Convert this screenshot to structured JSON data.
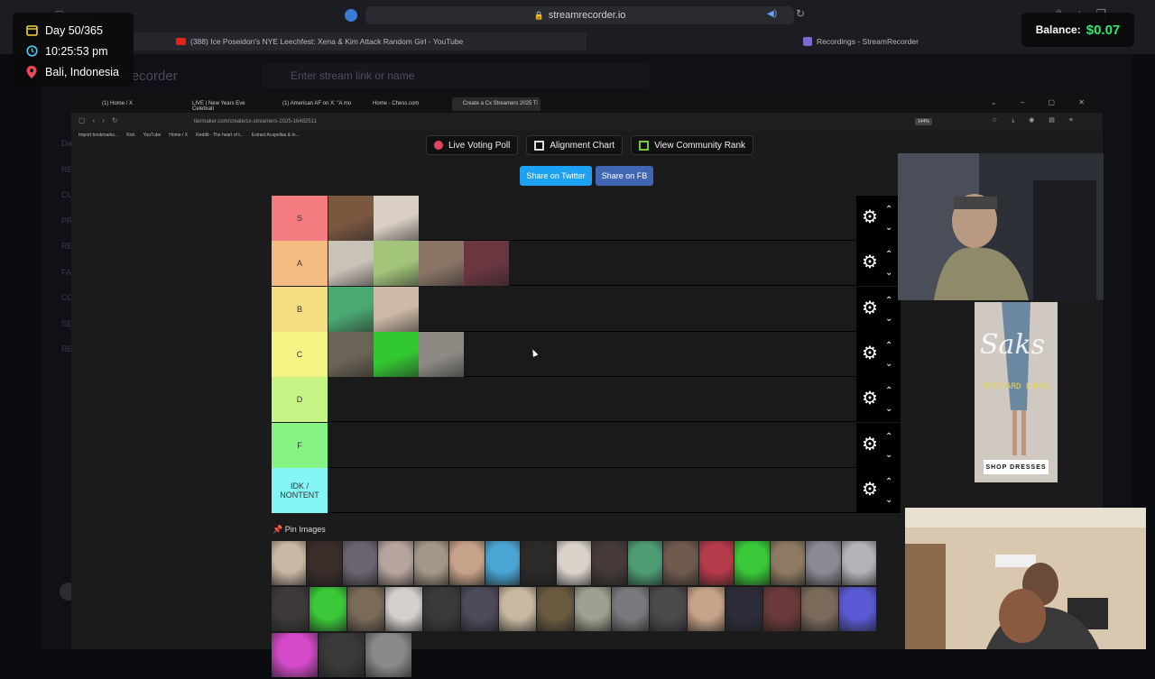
{
  "hud": {
    "day": "Day 50/365",
    "time": "10:25:53 pm",
    "location": "Bali, Indonesia",
    "balance_label": "Balance:",
    "balance_value": "$0.07"
  },
  "outer_browser": {
    "url": "streamrecorder.io",
    "tabs": [
      {
        "label": "(388) Ice Poseidon's NYE Leechfest: Xena & Kim Attack Random Girl - YouTube"
      },
      {
        "label": "Recordings - StreamRecorder"
      }
    ]
  },
  "streamrecorder": {
    "logo": "streamrecorder",
    "input_placeholder": "Enter stream link or name",
    "sidebar_items": [
      "Da",
      "RE",
      "CU",
      "PR",
      "RE",
      "FA",
      "CO",
      "SE",
      "RE"
    ]
  },
  "inner_browser": {
    "tabs": [
      "(1) Home / X",
      "LIVE | New Years Eve Celebrati",
      "(1) American AF on X: \"A mo",
      "Home - Chess.com",
      "Create a Cx Streamers 2025 Ti"
    ],
    "url": "tiermaker.com/create/cx-streamers-2025-16482511",
    "zoom": "144%",
    "bookmarks": [
      "Import bookmarks...",
      "Kick",
      "YouTube",
      "Home / X",
      "Reddit - The heart of t...",
      "Extract Acapellas & In..."
    ]
  },
  "tiermaker": {
    "buttons": {
      "live_voting": "Live Voting Poll",
      "alignment": "Alignment Chart",
      "community": "View Community Rank",
      "share_twitter": "Share on Twitter",
      "share_fb": "Share on FB"
    },
    "tiers": [
      {
        "label": "S",
        "color": "#f47b7f",
        "items": [
          "#7a5840",
          "#d9cfc4"
        ],
        "item_names": [
          "thumb-s-1",
          "thumb-s-2"
        ]
      },
      {
        "label": "A",
        "color": "#f5bb80",
        "items": [
          "#c9c2b9",
          "#a3c57a",
          "#8a7566",
          "#6b3640"
        ]
      },
      {
        "label": "B",
        "color": "#f5dd82",
        "items": [
          "#4aa872",
          "#cdb9a5"
        ]
      },
      {
        "label": "C",
        "color": "#f4f484",
        "items": [
          "#6a6457",
          "#32c832",
          "#8d8a84"
        ]
      },
      {
        "label": "D",
        "color": "#c6f484",
        "items": []
      },
      {
        "label": "F",
        "color": "#86f482",
        "items": []
      },
      {
        "label": "IDK / NONTENT",
        "color": "#84f4f4",
        "items": []
      }
    ],
    "pin_title": "Pin Images",
    "pin_rows": [
      [
        "#c8b8a4",
        "#3a2d2a",
        "#6b6470",
        "#b6a59d",
        "#a59788",
        "#c7a28a",
        "#4aa5d4",
        "#2d2a2a",
        "#d9d3ca",
        "#453a38",
        "#4e9c74",
        "#6f5a4e",
        "#b53a4a",
        "#38c838",
        "#8e7a62",
        "#8a8a92",
        "#b2b2b7"
      ],
      [
        "#3e3a3c",
        "#3ac838",
        "#7a6a58",
        "#d4d0cc",
        "#3a3a3a",
        "#4d4a5a",
        "#c8b8a0",
        "#6a5a40",
        "#a0a090",
        "#7a7a7e",
        "#4d4a4c",
        "#c6a48a",
        "#2d2d3a",
        "#6a3a3a",
        "#7a6a5a",
        "#5a5ad4"
      ],
      [
        "#d44ac8",
        "#3a3a3a",
        "#8a8a8a"
      ]
    ]
  },
  "ad": {
    "brand": "Saks",
    "subtitle": "POSTCARD LOOKS",
    "cta": "SHOP DRESSES"
  }
}
